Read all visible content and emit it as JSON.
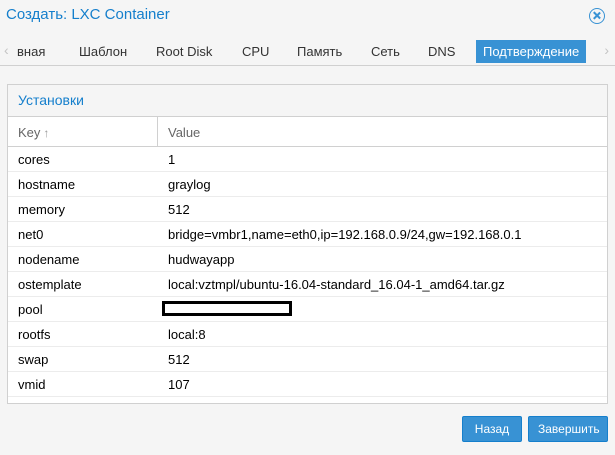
{
  "window": {
    "title": "Создать: LXC Container"
  },
  "tabs": [
    {
      "label": "вная",
      "active": false
    },
    {
      "label": "Шаблон",
      "active": false
    },
    {
      "label": "Root Disk",
      "active": false
    },
    {
      "label": "CPU",
      "active": false
    },
    {
      "label": "Память",
      "active": false
    },
    {
      "label": "Сеть",
      "active": false
    },
    {
      "label": "DNS",
      "active": false
    },
    {
      "label": "Подтверждение",
      "active": true
    }
  ],
  "panel": {
    "title": "Установки",
    "columns": {
      "key": "Key",
      "value": "Value"
    },
    "rows": [
      {
        "key": "cores",
        "value": "1"
      },
      {
        "key": "hostname",
        "value": "graylog"
      },
      {
        "key": "memory",
        "value": "512"
      },
      {
        "key": "net0",
        "value": "bridge=vmbr1,name=eth0,ip=192.168.0.9/24,gw=192.168.0.1"
      },
      {
        "key": "nodename",
        "value": "hudwayapp"
      },
      {
        "key": "ostemplate",
        "value": "local:vztmpl/ubuntu-16.04-standard_16.04-1_amd64.tar.gz"
      },
      {
        "key": "pool",
        "value": ""
      },
      {
        "key": "rootfs",
        "value": "local:8"
      },
      {
        "key": "swap",
        "value": "512"
      },
      {
        "key": "vmid",
        "value": "107"
      }
    ]
  },
  "footer": {
    "back_label": "Назад",
    "finish_label": "Завершить"
  },
  "colors": {
    "accent": "#3892d4",
    "title_text": "#157fcc"
  }
}
